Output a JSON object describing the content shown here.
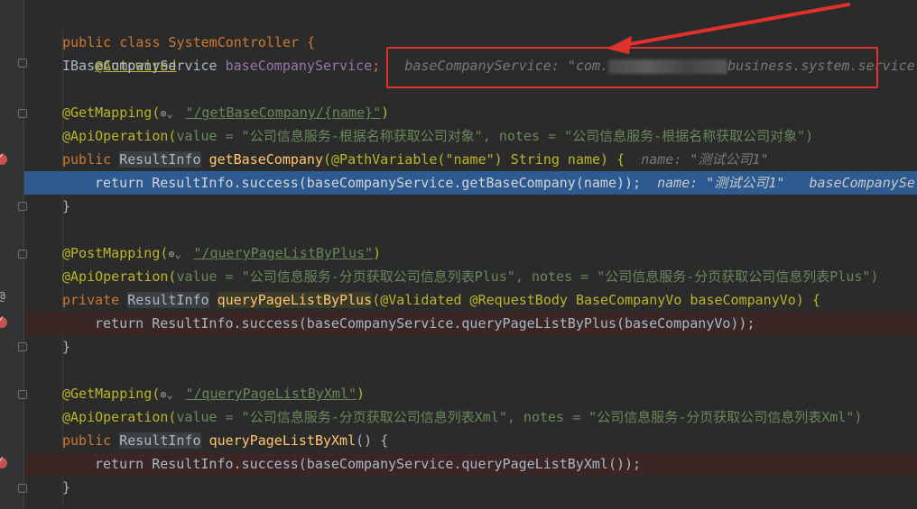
{
  "editor": {
    "lines": {
      "l1_class": "public class SystemController {",
      "l2_autowired": "@Autowired",
      "l3_type": "IBaseCompanyService",
      "l3_field": "baseCompanyService",
      "l3_semicolon": ";",
      "l3_hint_label": "baseCompanyService: \"com.",
      "l3_hint_value": "business.system.service.",
      "l5_annotation": "@GetMapping(",
      "l5_path": "\"/getBaseCompany/{name}\"",
      "l5_close": ")",
      "l6_annotation": "@ApiOperation(",
      "l6_rest": "value = \"公司信息服务-根据名称获取公司对象\", notes = \"公司信息服务-根据名称获取公司对象\")",
      "l7_public": "public ",
      "l7_type": "ResultInfo",
      "l7_method": "getBaseCompany",
      "l7_params": "(@PathVariable(\"name\") String name) {",
      "l7_hint": "name: \"测试公司1\"",
      "l8_code": "return ResultInfo.success(baseCompanyService.getBaseCompany(name));",
      "l8_hint1": "name: \"测试公司1\"",
      "l8_hint2": "baseCompanySe",
      "l9_close": "}",
      "l11_annotation": "@PostMapping(",
      "l11_path": "\"/queryPageListByPlus\"",
      "l11_close": ")",
      "l12_annotation": "@ApiOperation(",
      "l12_rest": "value = \"公司信息服务-分页获取公司信息列表Plus\", notes = \"公司信息服务-分页获取公司信息列表Plus\")",
      "l13_private": "private ",
      "l13_type": "ResultInfo",
      "l13_method": "queryPageListByPlus",
      "l13_params": "(@Validated @RequestBody BaseCompanyVo baseCompanyVo) {",
      "l14_code": "return ResultInfo.success(baseCompanyService.queryPageListByPlus(baseCompanyVo));",
      "l15_close": "}",
      "l17_annotation": "@GetMapping(",
      "l17_path": "\"/queryPageListByXml\"",
      "l17_close": ")",
      "l18_annotation": "@ApiOperation(",
      "l18_rest": "value = \"公司信息服务-分页获取公司信息列表Xml\", notes = \"公司信息服务-分页获取公司信息列表Xml\")",
      "l19_public": "public ",
      "l19_type": "ResultInfo",
      "l19_method": "queryPageListByXml",
      "l19_params": "() {",
      "l20_code": "return ResultInfo.success(baseCompanyService.queryPageListByXml());",
      "l21_close": "}"
    }
  },
  "colors": {
    "background": "#2b2b2b",
    "keyword": "#cc7832",
    "annotation": "#bbb529",
    "string": "#6a8759",
    "field": "#9876aa",
    "method": "#ffc66d",
    "current_line": "#2d5b91",
    "breakpoint_line": "#3b2626",
    "callout": "#e0322a"
  },
  "icons": {
    "globe": "globe-icon",
    "breakpoint": "breakpoint-icon",
    "fold": "fold-icon"
  }
}
